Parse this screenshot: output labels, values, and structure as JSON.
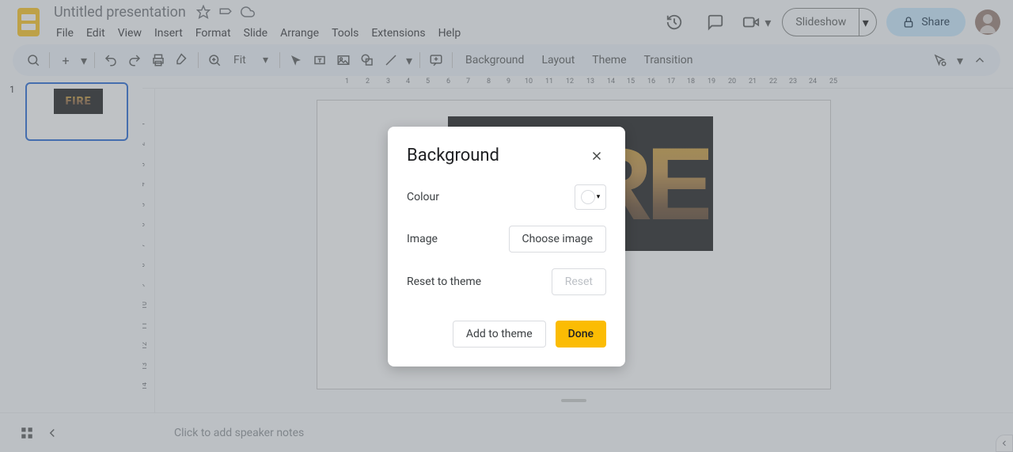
{
  "header": {
    "title": "Untitled presentation",
    "menus": [
      "File",
      "Edit",
      "View",
      "Insert",
      "Format",
      "Slide",
      "Arrange",
      "Tools",
      "Extensions",
      "Help"
    ],
    "slideshow_label": "Slideshow",
    "share_label": "Share"
  },
  "toolbar": {
    "zoom_value": "Fit",
    "text_tools": [
      "Background",
      "Layout",
      "Theme",
      "Transition"
    ]
  },
  "ruler": {
    "h_marks": [
      "1",
      "2",
      "3",
      "4",
      "5",
      "6",
      "7",
      "8",
      "9",
      "10",
      "11",
      "12",
      "13",
      "14",
      "15",
      "16",
      "17",
      "18",
      "19",
      "20",
      "21",
      "22",
      "23",
      "24",
      "25"
    ],
    "v_marks": [
      "1",
      "2",
      "3",
      "4",
      "5",
      "6",
      "7",
      "8",
      "9",
      "10",
      "11",
      "12",
      "13",
      "14"
    ]
  },
  "sidebar": {
    "slides": [
      {
        "num": "1"
      }
    ]
  },
  "slide": {
    "fire_text": "RE",
    "thumb_fire_text": "FIRE"
  },
  "notes": {
    "placeholder": "Click to add speaker notes"
  },
  "dialog": {
    "title": "Background",
    "colour_label": "Colour",
    "image_label": "Image",
    "choose_image_label": "Choose image",
    "reset_label": "Reset to theme",
    "reset_btn": "Reset",
    "add_theme_btn": "Add to theme",
    "done_btn": "Done"
  }
}
